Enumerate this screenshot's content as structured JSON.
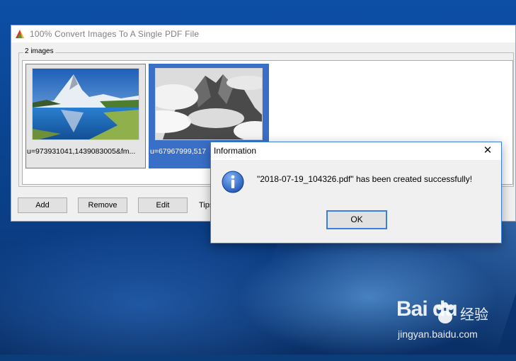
{
  "window": {
    "title": "100%  Convert Images To A Single PDF File"
  },
  "images_group": {
    "label": "2 images",
    "items": [
      {
        "caption": "u=973931041,1439083005&fm...",
        "selected": false
      },
      {
        "caption": "u=67967999,517",
        "selected": true
      }
    ]
  },
  "buttons": {
    "add": "Add",
    "remove": "Remove",
    "edit": "Edit",
    "tips": "Tips:"
  },
  "dialog": {
    "title": "Information",
    "close": "✕",
    "message": "\"2018-07-19_104326.pdf\" has been created successfully!",
    "ok": "OK"
  },
  "watermark": {
    "logo": "Bai du",
    "cn": "经验",
    "url": "jingyan.baidu.com"
  },
  "colors": {
    "selection": "#3a6fc8",
    "dialog_border": "#3c7fd8",
    "desktop": "#0d4fa6"
  }
}
